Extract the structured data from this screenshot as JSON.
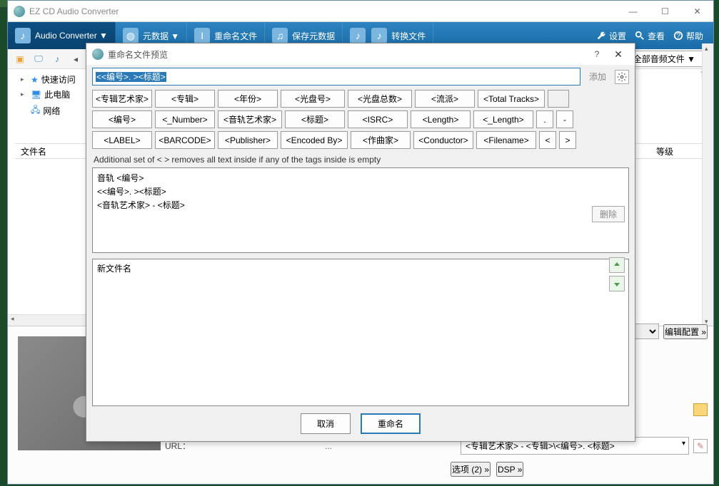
{
  "app": {
    "title": "EZ CD Audio Converter"
  },
  "toolbar": {
    "audio_converter": "Audio Converter ▼",
    "metadata": "元数据 ▼",
    "rename_files": "重命名文件",
    "save_metadata": "保存元数据",
    "convert_files": "转换文件",
    "settings": "设置",
    "view": "查看",
    "help": "帮助"
  },
  "subtoolbar": {
    "filter_label": "全部音频文件 ▼",
    "ke": "可"
  },
  "tree": {
    "quick_access": "快速访问",
    "this_pc": "此电脑",
    "network": "网络"
  },
  "list": {
    "filename_col": "文件名",
    "grade_col": "等级"
  },
  "bottom": {
    "url_label": "URL：",
    "url_val": "...",
    "pattern_value": "<专辑艺术家> - <专辑>\\<编号>. <标题>",
    "options_btn": "选项 (2) »",
    "dsp_btn": "DSP »",
    "edit_config": "编辑配置 »"
  },
  "dialog": {
    "title": "重命名文件预览",
    "pattern_selected": "<<编号>. ><标题>",
    "add_btn": "添加",
    "hint": "Additional set of < > removes all text inside if any of the tags inside is empty",
    "delete_btn": "删除",
    "tags_row1": [
      "<专辑艺术家>",
      "<专辑>",
      "<年份>",
      "<光盘号>",
      "<光盘总数>",
      "<流派>",
      "<Total Tracks>"
    ],
    "tags_row2": [
      "<编号>",
      "<_Number>",
      "<音轨艺术家>",
      "<标题>",
      "<ISRC>",
      "<Length>",
      "<_Length>",
      ".",
      "-"
    ],
    "tags_row3": [
      "<LABEL>",
      "<BARCODE>",
      "<Publisher>",
      "<Encoded By>",
      "<作曲家>",
      "<Conductor>",
      "<Filename>",
      "<",
      ">"
    ],
    "templates": [
      "音轨 <编号>",
      "<<编号>. ><标题>",
      "<音轨艺术家> - <标题>"
    ],
    "preview_header": "新文件名",
    "cancel": "取消",
    "rename": "重命名"
  }
}
